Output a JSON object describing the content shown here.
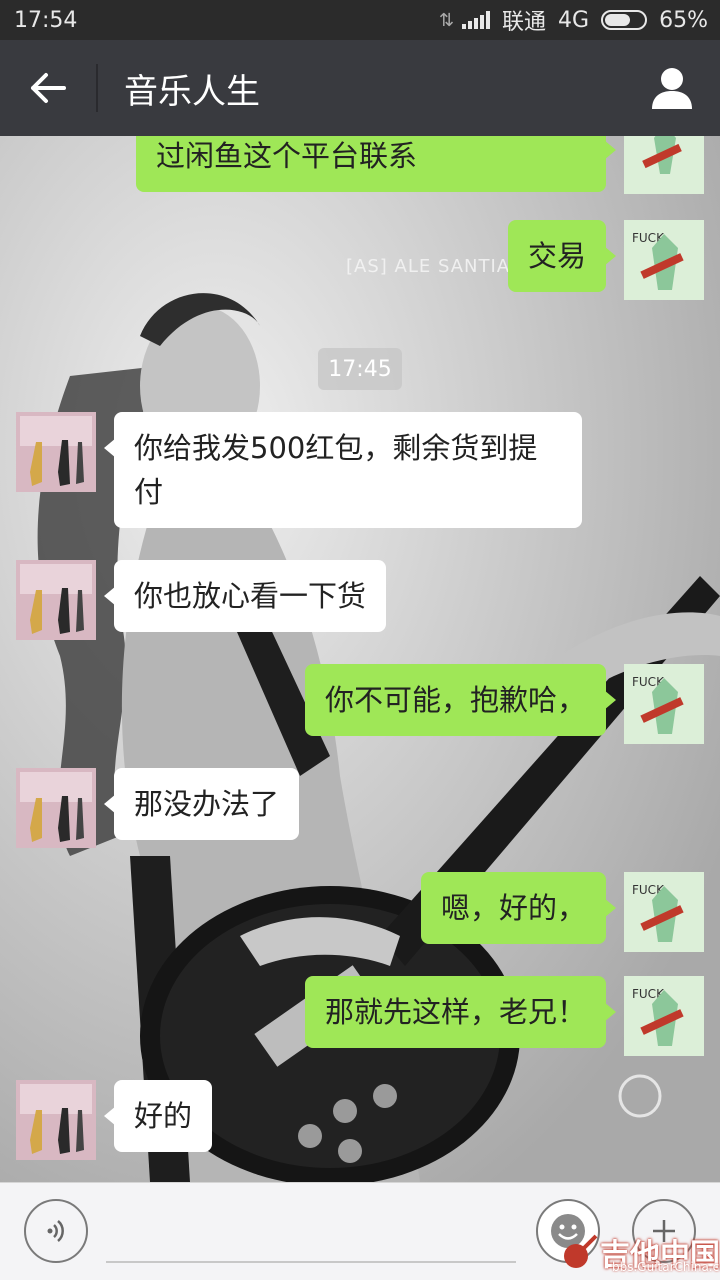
{
  "status_bar": {
    "time": "17:54",
    "carrier": "联通",
    "network": "4G",
    "battery": "65%",
    "battery_level": 0.65
  },
  "header": {
    "title": "音乐人生"
  },
  "wallpaper": {
    "watermark": "[AS] ALE SANTIAG"
  },
  "chat": {
    "timestamp": "17:45",
    "messages": [
      {
        "side": "out",
        "text": "过闲鱼这个平台联系"
      },
      {
        "side": "out",
        "text": "交易"
      },
      {
        "side": "in",
        "text": "你给我发500红包，剩余货到提付"
      },
      {
        "side": "in",
        "text": "你也放心看一下货"
      },
      {
        "side": "out",
        "text": "你不可能，抱歉哈，"
      },
      {
        "side": "in",
        "text": "那没办法了"
      },
      {
        "side": "out",
        "text": "嗯，好的，"
      },
      {
        "side": "out",
        "text": "那就先这样，老兄！"
      },
      {
        "side": "in",
        "text": "好的"
      }
    ]
  },
  "input_bar": {
    "text_value": ""
  },
  "site_watermark": {
    "main": "吉他中国",
    "sub": "bbs.GuitarChina.com"
  },
  "colors": {
    "app_bar": "#393a3f",
    "status_bar": "#2b2b2b",
    "bubble_out": "#9fe757",
    "bubble_in": "#ffffff"
  }
}
